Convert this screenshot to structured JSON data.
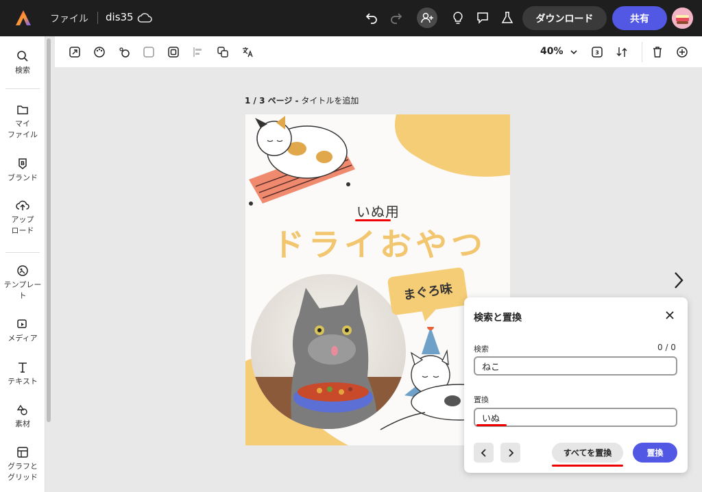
{
  "topbar": {
    "file_menu": "ファイル",
    "doc_name": "dis35",
    "download_label": "ダウンロード",
    "share_label": "共有",
    "accent": "#5258e4"
  },
  "sidebar": {
    "items": [
      {
        "label": "検索",
        "icon": "search-icon"
      },
      {
        "label": "マイ\nファイル",
        "icon": "folder-icon"
      },
      {
        "label": "ブランド",
        "icon": "brand-icon"
      },
      {
        "label": "アップ\nロード",
        "icon": "upload-icon"
      },
      {
        "label": "テンプレー\nト",
        "icon": "template-icon"
      },
      {
        "label": "メディア",
        "icon": "media-icon"
      },
      {
        "label": "テキスト",
        "icon": "text-icon"
      },
      {
        "label": "素材",
        "icon": "elements-icon"
      },
      {
        "label": "グラフと\nグリッド",
        "icon": "grid-icon"
      }
    ]
  },
  "toolbar": {
    "zoom": "40%"
  },
  "canvas": {
    "page_indicator": "1 / 3 ページ -",
    "page_title_placeholder": "タイトルを追加",
    "text_small": "いぬ用",
    "text_big": "ドライおやつ",
    "bubble_text": "まぐろ味"
  },
  "dialog": {
    "title": "検索と置換",
    "find_label": "検索",
    "find_count": "0 / 0",
    "find_value": "ねこ",
    "replace_label": "置換",
    "replace_value": "いぬ",
    "replace_all_label": "すべてを置換",
    "replace_label_btn": "置換"
  }
}
